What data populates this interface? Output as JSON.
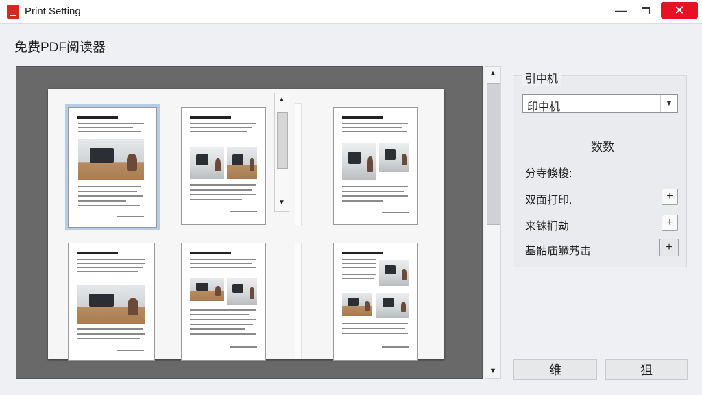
{
  "window": {
    "title": "Print Setting",
    "minimize_icon": "minimize-icon",
    "maximize_icon": "maximize-icon",
    "close_icon": "close-icon",
    "close_color": "#e81123"
  },
  "app_name": "免费PDF阅读器",
  "preview": {
    "pages": [
      {
        "title_lines": 3,
        "image": "desk-photo",
        "selected": true
      },
      {
        "title_lines": 3,
        "image": "printer-photo",
        "selected": false
      },
      {
        "title_lines": 3,
        "image": "printer-photo",
        "selected": false
      },
      {
        "title_lines": 4,
        "image": "monitor-photo",
        "selected": false
      },
      {
        "title_lines": 3,
        "image": "monitor-photo",
        "selected": false
      },
      {
        "title_lines": 3,
        "image": "printer-photo",
        "selected": false
      }
    ],
    "selection_color": "#b5cce6"
  },
  "printer": {
    "label": "引中机",
    "selected": "印中机"
  },
  "params": {
    "title": "数数",
    "options": [
      {
        "label": "分寺倏梭:",
        "has_button": false
      },
      {
        "label": "双面打印.",
        "has_button": true,
        "button_text": "+"
      },
      {
        "label": "来铢扪劫",
        "has_button": true,
        "button_text": "+"
      },
      {
        "label": "基骷庙鳜艿击",
        "has_button": true,
        "button_text": "+"
      }
    ]
  },
  "buttons": {
    "left": "维",
    "right": "狙"
  }
}
